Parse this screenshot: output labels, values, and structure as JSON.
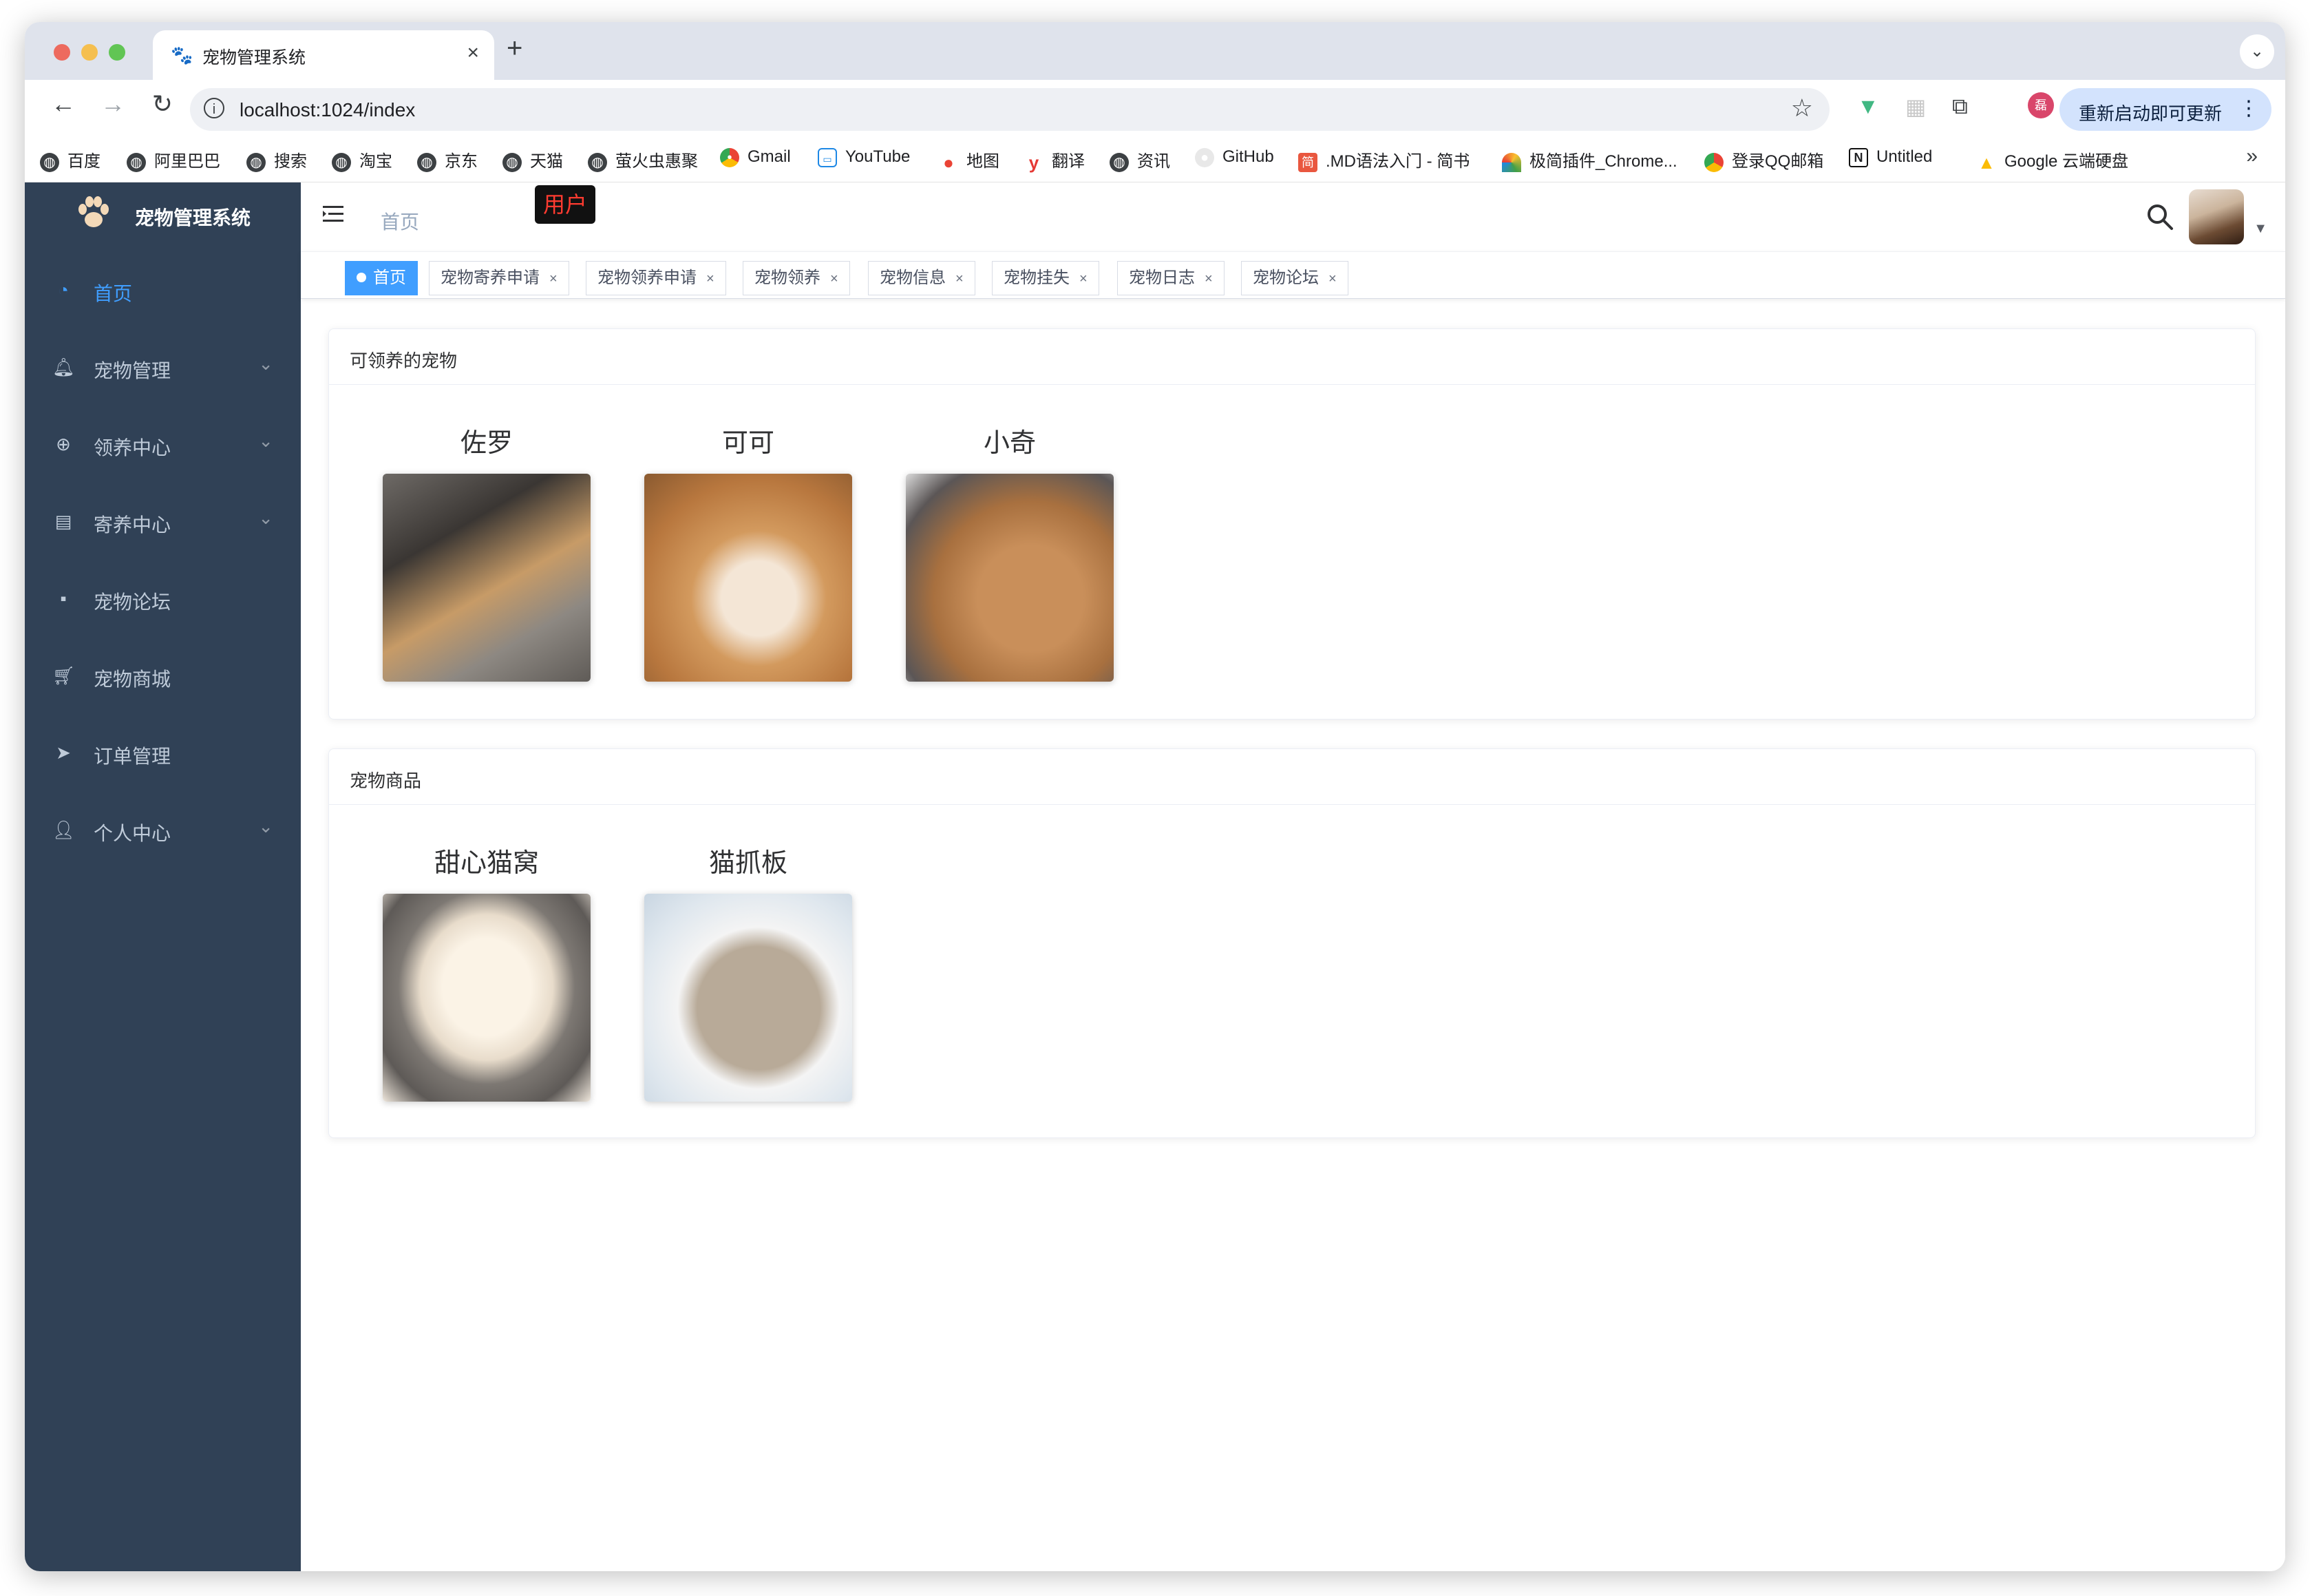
{
  "browser": {
    "tab_title": "宠物管理系统",
    "url": "localhost:1024/index",
    "update_label": "重新启动即可更新",
    "bookmarks": [
      {
        "label": "百度",
        "icon": "globe-icon"
      },
      {
        "label": "阿里巴巴",
        "icon": "globe-icon"
      },
      {
        "label": "搜索",
        "icon": "globe-icon"
      },
      {
        "label": "淘宝",
        "icon": "globe-icon"
      },
      {
        "label": "京东",
        "icon": "globe-icon"
      },
      {
        "label": "天猫",
        "icon": "globe-icon"
      },
      {
        "label": "萤火虫惠聚",
        "icon": "globe-icon"
      },
      {
        "label": "Gmail",
        "icon": "chrome-icon"
      },
      {
        "label": "YouTube",
        "icon": "tv-icon"
      },
      {
        "label": "地图",
        "icon": "map-pin-icon"
      },
      {
        "label": "翻译",
        "icon": "youdao-icon"
      },
      {
        "label": "资讯",
        "icon": "globe-icon"
      },
      {
        "label": "GitHub",
        "icon": "github-icon"
      },
      {
        "label": ".MD语法入门 - 简书",
        "icon": "jianshu-icon"
      },
      {
        "label": "极简插件_Chrome...",
        "icon": "rainbow-icon"
      },
      {
        "label": "登录QQ邮箱",
        "icon": "chrome-icon"
      },
      {
        "label": "Untitled",
        "icon": "notion-icon"
      },
      {
        "label": "Google 云端硬盘",
        "icon": "drive-icon"
      }
    ]
  },
  "app": {
    "brand": "宠物管理系统",
    "menu": [
      {
        "label": "首页",
        "icon": "dashboard-icon",
        "active": true,
        "has_children": false
      },
      {
        "label": "宠物管理",
        "icon": "bell-icon",
        "active": false,
        "has_children": true
      },
      {
        "label": "领养中心",
        "icon": "lifebuoy-icon",
        "active": false,
        "has_children": true
      },
      {
        "label": "寄养中心",
        "icon": "document-icon",
        "active": false,
        "has_children": true
      },
      {
        "label": "宠物论坛",
        "icon": "chat-icon",
        "active": false,
        "has_children": false
      },
      {
        "label": "宠物商城",
        "icon": "cart-icon",
        "active": false,
        "has_children": false
      },
      {
        "label": "订单管理",
        "icon": "send-icon",
        "active": false,
        "has_children": false
      },
      {
        "label": "个人中心",
        "icon": "user-icon",
        "active": false,
        "has_children": true
      }
    ],
    "breadcrumb": "首页",
    "tooltip": "用户",
    "tags": [
      {
        "label": "首页",
        "active": true
      },
      {
        "label": "宠物寄养申请",
        "active": false
      },
      {
        "label": "宠物领养申请",
        "active": false
      },
      {
        "label": "宠物领养",
        "active": false
      },
      {
        "label": "宠物信息",
        "active": false
      },
      {
        "label": "宠物挂失",
        "active": false
      },
      {
        "label": "宠物日志",
        "active": false
      },
      {
        "label": "宠物论坛",
        "active": false
      }
    ],
    "sections": [
      {
        "title": "可领养的宠物",
        "items": [
          {
            "name": "佐罗",
            "image": "two dogs with mask-like eye markings on pavement"
          },
          {
            "name": "可可",
            "image": "shiba inu dog face close-up"
          },
          {
            "name": "小奇",
            "image": "tan dog face close-up indoors"
          }
        ]
      },
      {
        "title": "宠物商品",
        "items": [
          {
            "name": "甜心猫窝",
            "image": "gray felt cat bed with cat inside"
          },
          {
            "name": "猫抓板",
            "image": "white cloud-shaped cat scratching board"
          }
        ]
      }
    ]
  }
}
